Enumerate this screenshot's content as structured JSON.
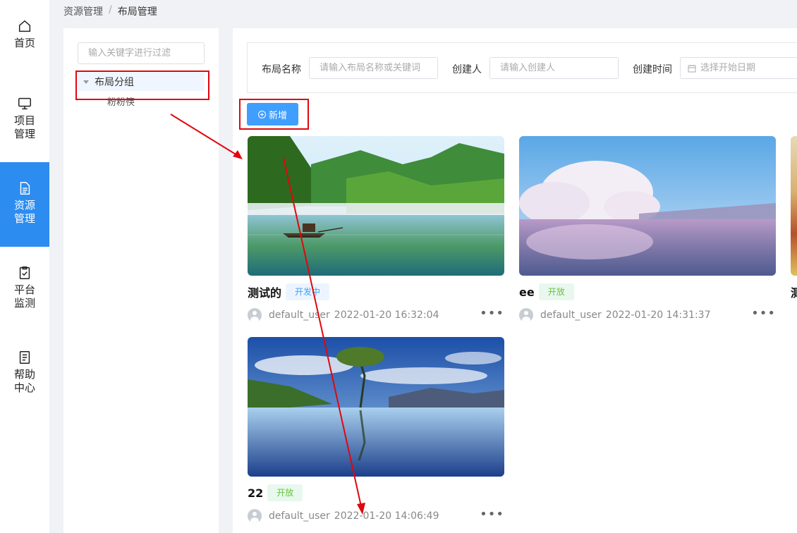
{
  "nav": {
    "items": [
      {
        "label": "首页",
        "icon": "home-icon"
      },
      {
        "label": "项目\n管理",
        "icon": "monitor-icon"
      },
      {
        "label": "资源\n管理",
        "icon": "document-icon",
        "active": true
      },
      {
        "label": "平台\n监测",
        "icon": "clipboard-check-icon"
      },
      {
        "label": "帮助\n中心",
        "icon": "help-doc-icon"
      }
    ]
  },
  "breadcrumb": [
    "资源管理",
    "布局管理"
  ],
  "tree": {
    "filter_placeholder": "输入关键字进行过滤",
    "group_label": "布局分组",
    "child_label": "粉粉筷"
  },
  "search": {
    "name_label": "布局名称",
    "name_placeholder": "请输入布局名称或关键词",
    "creator_label": "创建人",
    "creator_placeholder": "请输入创建人",
    "time_label": "创建时间",
    "time_placeholder": "选择开始日期"
  },
  "toolbar": {
    "add_label": "新增"
  },
  "cards": [
    {
      "title": "测试的",
      "status": "开发中",
      "user": "default_user",
      "time": "2022-01-20 16:32:04"
    },
    {
      "title": "ee",
      "status": "开放",
      "user": "default_user",
      "time": "2022-01-20 14:31:37"
    },
    {
      "title": "测",
      "status": "",
      "user": "",
      "time": ""
    },
    {
      "title": "22",
      "status": "开放",
      "user": "default_user",
      "time": "2022-01-20 14:06:49"
    }
  ],
  "more_label": "•••",
  "colors": {
    "primary": "#409eff",
    "nav_active": "#2d8cf0",
    "annotation": "#e0070d"
  }
}
